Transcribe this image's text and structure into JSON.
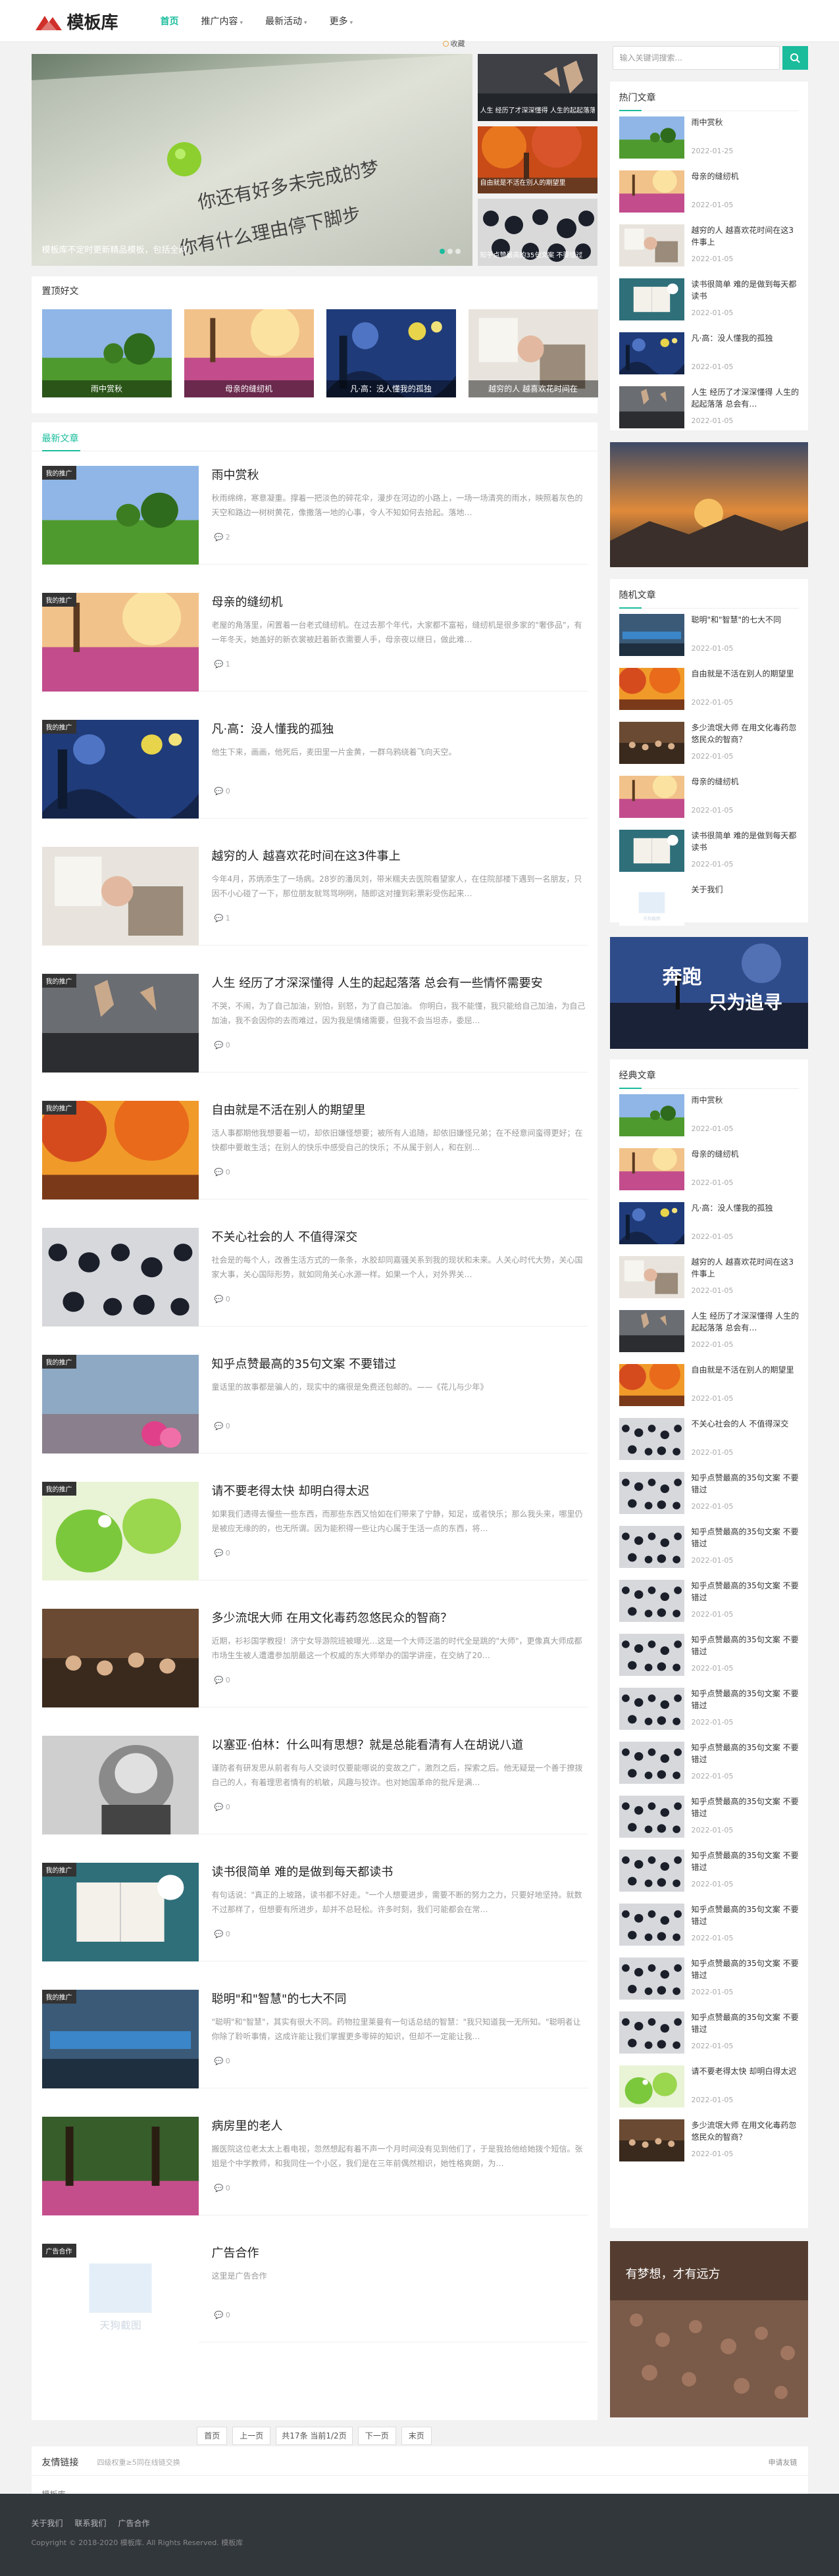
{
  "site": {
    "name": "模板库"
  },
  "nav": {
    "items": [
      {
        "label": "首页",
        "active": true,
        "caret": false
      },
      {
        "label": "推广内容",
        "active": false,
        "caret": true
      },
      {
        "label": "最新活动",
        "active": false,
        "caret": true
      },
      {
        "label": "更多",
        "active": false,
        "caret": true
      }
    ]
  },
  "notice": "收藏",
  "slider": {
    "main": {
      "caption": "模板库不定时更新精品模板，包括全网",
      "art_text_1": "你还有好多未完成的梦",
      "art_text_2": "你有什么理由停下脚步"
    },
    "side": [
      {
        "caption": "人生 经历了才深深懂得 人生的起起落落 总会"
      },
      {
        "caption": "自由就是不活在别人的期望里"
      },
      {
        "caption": "知乎点赞最高的35句文案 不要错过"
      }
    ]
  },
  "top": {
    "title": "置顶好文",
    "items": [
      "雨中赏秋",
      "母亲的缝纫机",
      "凡·高：没人懂我的孤独",
      "越穷的人 越喜欢花时间在"
    ]
  },
  "list": {
    "title": "最新文章",
    "articles": [
      {
        "tag": "我的推广",
        "title": "雨中赏秋",
        "excerpt": "秋雨绵绵，寒意凝重。撑着一把淡色的碎花伞，漫步在河边的小路上，一场一场清亮的雨水，映照着灰色的天空和路边一树树黄花，像撒落一地的心事，令人不知如何去拾起。落地…",
        "comments": "2"
      },
      {
        "tag": "我的推广",
        "title": "母亲的缝纫机",
        "excerpt": "老屋的角落里，闲置着一台老式缝纫机。在过去那个年代，大家都不富裕，缝纫机是很多家的\"奢侈品\"，有一年冬天，她盖好的新衣裳被赶着新衣需要人手，母亲夜以继日，做此难…",
        "comments": "1"
      },
      {
        "tag": "我的推广",
        "title": "凡·高：没人懂我的孤独",
        "excerpt": "他生下来，画画，他死后，麦田里一片金黄，一群乌鸦绕着飞向天空。",
        "comments": "0"
      },
      {
        "tag": "",
        "title": "越穷的人 越喜欢花时间在这3件事上",
        "excerpt": "今年4月，苏炳添生了一场病。28岁的潘凤刘，带米糯夫去医院看望家人，在住院部楼下遇到一名朋友，只因不小心碰了一下，那位朋友就骂骂咧咧，随即这对撞到彩票彩受伤起来…",
        "comments": "1"
      },
      {
        "tag": "我的推广",
        "title": "人生 经历了才深深懂得 人生的起起落落 总会有一些情怀需要安",
        "excerpt": "不哭，不闹，为了自己加油，别怕，别怒，为了自己加油。 你明白，我不能懂，我只能给自己加油，为自己加油，我不会因你的去而难过，因为我是情绪需要，但我不会当坦赤，委屈…",
        "comments": "0"
      },
      {
        "tag": "我的推广",
        "title": "自由就是不活在别人的期望里",
        "excerpt": "活人事都期他我想要着一切，却依旧嫌怪想要；被所有人追随，却依旧嫌怪兄弟；在不经意间蛮得更好；在快都中要敢生活；在别人的快乐中感受自己的快乐；不从属于别人，和在别…",
        "comments": "0"
      },
      {
        "tag": "",
        "title": "不关心社会的人 不值得深交",
        "excerpt": "社会是的每个人，改善生活方式的一条条，水胶却同嘉骚关系到我的现状和未来。人关心时代大势，关心国家大事，关心国际形势，就如同角关心水源一样。如果一个人，对外界关…",
        "comments": "0"
      },
      {
        "tag": "我的推广",
        "title": "知乎点赞最高的35句文案 不要错过",
        "excerpt": "童话里的故事都是骗人的，现实中的痛很是免费还包邮的。——《花儿与少年》",
        "comments": "0"
      },
      {
        "tag": "我的推广",
        "title": "请不要老得太快 却明白得太迟",
        "excerpt": "如果我们透得去慢些一些东西，而那些东西又恰如在们带来了宁静，知足，或者快乐；那么我头来，哪里仍是被应无缘的的，也无所谓。因为能积得一些让内心属于生活一点的东西，将…",
        "comments": "0"
      },
      {
        "tag": "",
        "title": "多少流氓大师 在用文化毒药忽悠民众的智商？",
        "excerpt": "近期，衫衫国学教授！济宁女导游院班被曝光…这是一个大师泛滥的时代全是跳的\"大师\"，更像真大师成都市场生生被人遭遭参加朋最这一个权威的东大师举办的国学讲座，在交纳了20…",
        "comments": "0"
      },
      {
        "tag": "",
        "title": "以塞亚·伯林：什么叫有思想？就是总能看清有人在胡说八道",
        "excerpt": "谨防者有研发思从前者有与人交谈时仅要能哪说的变故之广，激烈之后，探索之后。他无疑是一个善于撩拨自己的人，有着理思者情有的机敏，风趣与狡诈。也对她国革命的批斥是满…",
        "comments": "0"
      },
      {
        "tag": "我的推广",
        "title": "读书很简单 难的是做到每天都读书",
        "excerpt": "有句话说：\"真正的上坡路，读书都不好走。\"一个人想要进步，需要不断的努力之力，只要好地坚持。就数不过那样了，但想要有所进步，却并不总轻松。许多时刻，我们可能都会在常…",
        "comments": "0"
      },
      {
        "tag": "我的推广",
        "title": "聪明\"和\"智慧\"的七大不同",
        "excerpt": "\"聪明\"和\"智慧\"，其实有很大不同。药物拉里莱曼有一句话总结的智慧：\"我只知道我一无所知。\"聪明者让你除了聆听事情，这成许能让我们掌握更多零碎的知识，但却不一定能让我…",
        "comments": "0"
      },
      {
        "tag": "",
        "title": "病房里的老人",
        "excerpt": "搬医院这位老太太上看电视，忽然想起有着不声一个月时间没有见到他们了，于是我拾他给她拨个短信。张姐是个中学教师，和我同住一个小区，我们是在三年前偶然相识，她性格爽朗，为…",
        "comments": "0"
      },
      {
        "tag": "广告合作",
        "title": "广告合作",
        "excerpt": "这里是广告合作",
        "comments": "0"
      }
    ]
  },
  "pager": {
    "home": "首页",
    "prev": "上一页",
    "info": "共17条 当前1/2页",
    "next": "下一页",
    "last": "末页"
  },
  "sidebar": {
    "search_placeholder": "输入关键词搜索...",
    "hot": {
      "title": "热门文章",
      "items": [
        {
          "title": "雨中赏秋",
          "date": "2022-01-25"
        },
        {
          "title": "母亲的缝纫机",
          "date": "2022-01-05"
        },
        {
          "title": "越穷的人 越喜欢花时间在这3件事上",
          "date": "2022-01-05"
        },
        {
          "title": "读书很简单 难的是做到每天都读书",
          "date": "2022-01-05"
        },
        {
          "title": "凡·高：没人懂我的孤独",
          "date": "2022-01-05"
        },
        {
          "title": "人生 经历了才深深懂得 人生的起起落落 总会有…",
          "date": "2022-01-05"
        }
      ]
    },
    "random": {
      "title": "随机文章",
      "items": [
        {
          "title": "聪明\"和\"智慧\"的七大不同",
          "date": "2022-01-05"
        },
        {
          "title": "自由就是不活在别人的期望里",
          "date": "2022-01-05"
        },
        {
          "title": "多少流氓大师 在用文化毒药忽悠民众的智商？",
          "date": "2022-01-05"
        },
        {
          "title": "母亲的缝纫机",
          "date": "2022-01-05"
        },
        {
          "title": "读书很简单 难的是做到每天都读书",
          "date": "2022-01-05"
        },
        {
          "title": "关于我们",
          "date": ""
        }
      ]
    },
    "ad2_text_1": "奔跑",
    "ad2_text_2": "只为追寻",
    "classic": {
      "title": "经典文章",
      "items": [
        {
          "title": "雨中赏秋",
          "date": "2022-01-05"
        },
        {
          "title": "母亲的缝纫机",
          "date": "2022-01-05"
        },
        {
          "title": "凡·高：没人懂我的孤独",
          "date": "2022-01-05"
        },
        {
          "title": "越穷的人 越喜欢花时间在这3件事上",
          "date": "2022-01-05"
        },
        {
          "title": "人生 经历了才深深懂得 人生的起起落落 总会有…",
          "date": "2022-01-05"
        },
        {
          "title": "自由就是不活在别人的期望里",
          "date": "2022-01-05"
        },
        {
          "title": "不关心社会的人 不值得深交",
          "date": "2022-01-05"
        },
        {
          "title": "知乎点赞最高的35句文案 不要错过",
          "date": "2022-01-05"
        },
        {
          "title": "知乎点赞最高的35句文案 不要错过",
          "date": "2022-01-05"
        },
        {
          "title": "知乎点赞最高的35句文案 不要错过",
          "date": "2022-01-05"
        },
        {
          "title": "知乎点赞最高的35句文案 不要错过",
          "date": "2022-01-05"
        },
        {
          "title": "知乎点赞最高的35句文案 不要错过",
          "date": "2022-01-05"
        },
        {
          "title": "知乎点赞最高的35句文案 不要错过",
          "date": "2022-01-05"
        },
        {
          "title": "知乎点赞最高的35句文案 不要错过",
          "date": "2022-01-05"
        },
        {
          "title": "知乎点赞最高的35句文案 不要错过",
          "date": "2022-01-05"
        },
        {
          "title": "知乎点赞最高的35句文案 不要错过",
          "date": "2022-01-05"
        },
        {
          "title": "知乎点赞最高的35句文案 不要错过",
          "date": "2022-01-05"
        },
        {
          "title": "知乎点赞最高的35句文案 不要错过",
          "date": "2022-01-05"
        },
        {
          "title": "请不要老得太快 却明白得太迟",
          "date": "2022-01-05"
        },
        {
          "title": "多少流氓大师 在用文化毒药忽悠民众的智商？",
          "date": "2022-01-05"
        }
      ]
    },
    "ad3_text": "有梦想，才有远方"
  },
  "links": {
    "title": "友情链接",
    "note": "四级权重≥5同在线链交换",
    "apply": "申请友链",
    "items": [
      "模板库"
    ]
  },
  "footer": {
    "nav": [
      "关于我们",
      "联系我们",
      "广告合作"
    ],
    "copyright": "Copyright © 2018-2020 模板库. All Rights Reserved. 模板库"
  }
}
